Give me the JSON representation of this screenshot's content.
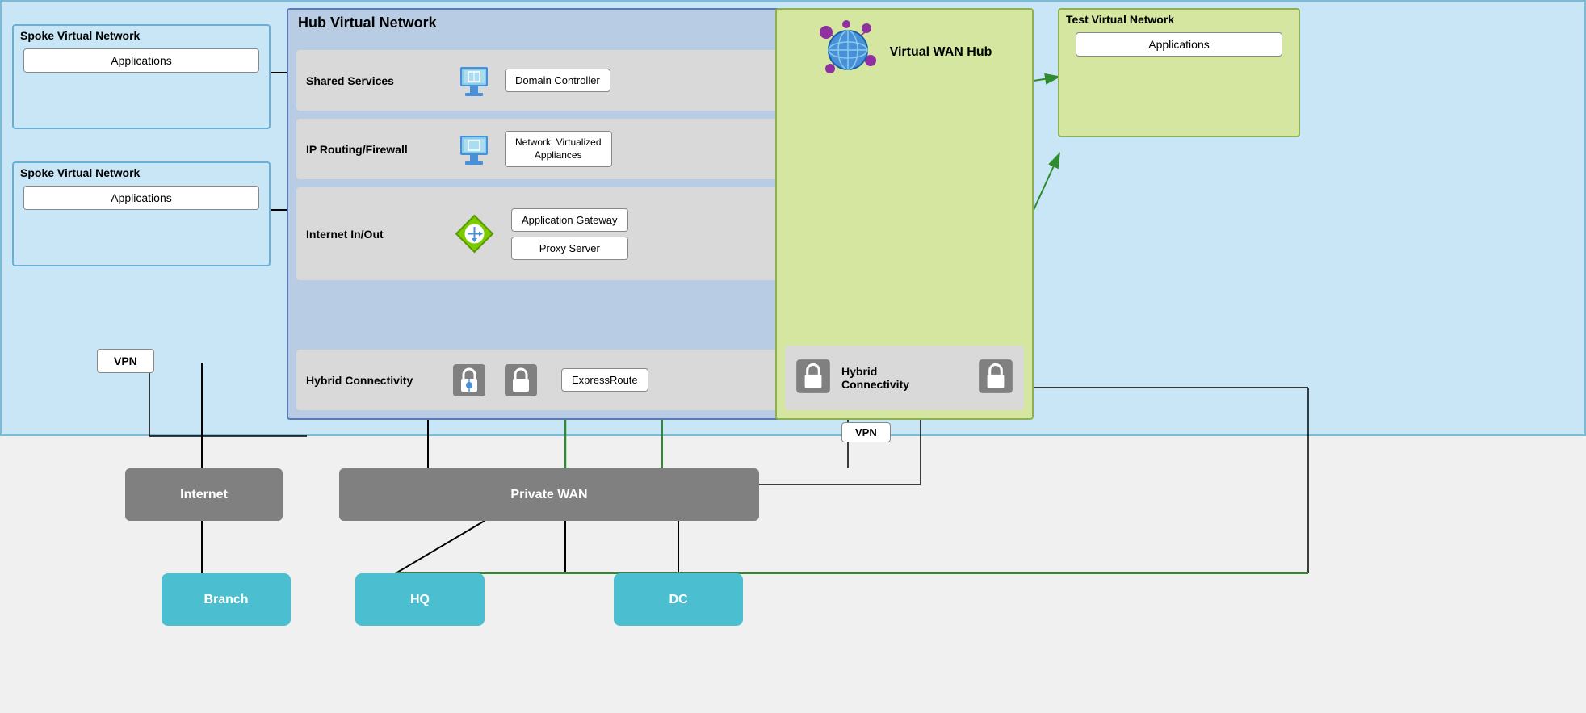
{
  "spoke1": {
    "title": "Spoke Virtual Network",
    "app_label": "Applications"
  },
  "spoke2": {
    "title": "Spoke Virtual Network",
    "app_label": "Applications"
  },
  "hub": {
    "title": "Hub Virtual Network",
    "rows": [
      {
        "label": "Shared Services",
        "service": "Domain Controller"
      },
      {
        "label": "IP Routing/Firewall",
        "service": "Network  Virtualized\nAppliances"
      },
      {
        "label": "Internet In/Out",
        "services": [
          "Application Gateway",
          "Proxy Server"
        ]
      },
      {
        "label": "Hybrid Connectivity",
        "service": "ExpressRoute"
      }
    ]
  },
  "vwan": {
    "title": "Virtual WAN Hub",
    "hybrid_label": "Hybrid\nConnectivity",
    "vpn_label": "VPN"
  },
  "test_vnet": {
    "title": "Test Virtual Network",
    "app_label": "Applications"
  },
  "bottom": {
    "internet_label": "Internet",
    "private_wan_label": "Private WAN",
    "branch_label": "Branch",
    "hq_label": "HQ",
    "dc_label": "DC",
    "vpn_label": "VPN"
  }
}
